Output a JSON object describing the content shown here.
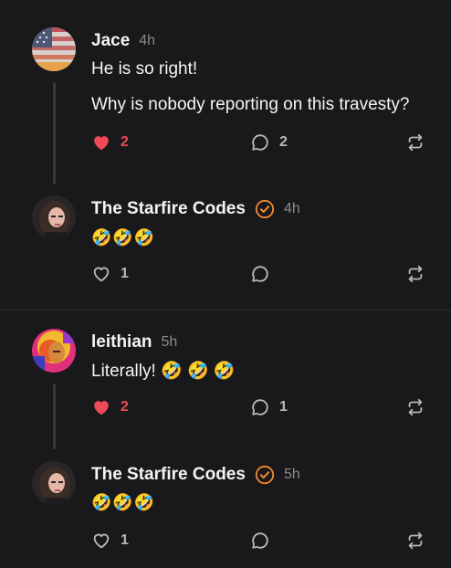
{
  "posts": [
    {
      "author": "Jace",
      "time": "4h",
      "verified": false,
      "lines": [
        "He is so right!",
        "Why is nobody reporting on this travesty?"
      ],
      "likes": "2",
      "liked": true,
      "replies": "2"
    },
    {
      "author": "The Starfire Codes",
      "time": "4h",
      "verified": true,
      "lines": [
        "🤣🤣🤣"
      ],
      "likes": "1",
      "liked": false,
      "replies": ""
    },
    {
      "author": "leithian",
      "time": "5h",
      "verified": false,
      "lines": [
        "Literally! 🤣 🤣 🤣"
      ],
      "likes": "2",
      "liked": true,
      "replies": "1"
    },
    {
      "author": "The Starfire Codes",
      "time": "5h",
      "verified": true,
      "lines": [
        "🤣🤣🤣"
      ],
      "likes": "1",
      "liked": false,
      "replies": ""
    }
  ],
  "colors": {
    "like_active": "#ef4a55",
    "verified": "#f28a2e",
    "background": "#19191b"
  },
  "icons": [
    "heart-icon",
    "reply-icon",
    "repost-icon",
    "verified-badge-icon"
  ]
}
